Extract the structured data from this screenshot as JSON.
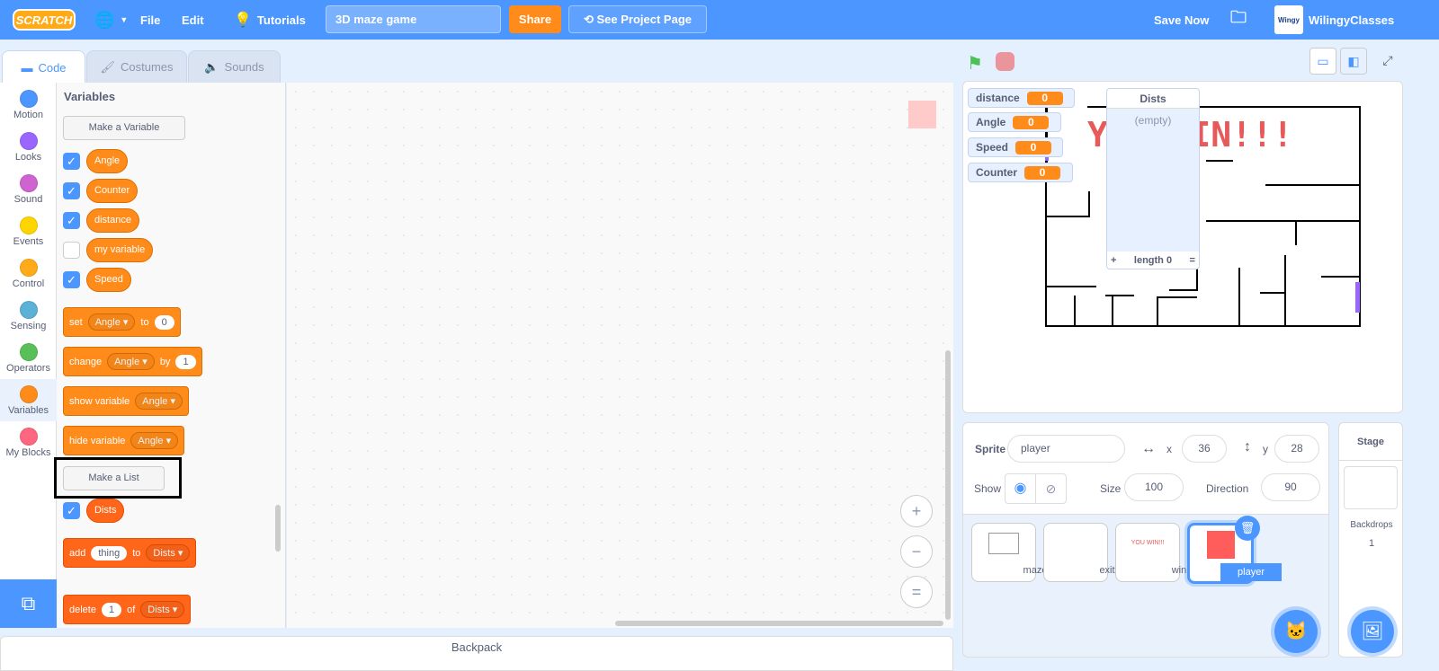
{
  "header": {
    "logo": "SCRATCH",
    "file": "File",
    "edit": "Edit",
    "tutorials": "Tutorials",
    "project_title": "3D maze game",
    "share": "Share",
    "see_project_page": "See Project Page",
    "save_now": "Save Now",
    "username": "WilingyClasses",
    "avatar_text": "Wingy"
  },
  "tabs": [
    {
      "label": "Code"
    },
    {
      "label": "Costumes"
    },
    {
      "label": "Sounds"
    }
  ],
  "categories": [
    {
      "label": "Motion",
      "color": "#4c97ff"
    },
    {
      "label": "Looks",
      "color": "#9966ff"
    },
    {
      "label": "Sound",
      "color": "#cf63cf"
    },
    {
      "label": "Events",
      "color": "#ffd500"
    },
    {
      "label": "Control",
      "color": "#ffab19"
    },
    {
      "label": "Sensing",
      "color": "#5cb1d6"
    },
    {
      "label": "Operators",
      "color": "#59c059"
    },
    {
      "label": "Variables",
      "color": "#ff8c1a"
    },
    {
      "label": "My Blocks",
      "color": "#ff6680"
    }
  ],
  "palette": {
    "title": "Variables",
    "make_variable": "Make a Variable",
    "variables": [
      {
        "name": "Angle",
        "checked": true
      },
      {
        "name": "Counter",
        "checked": true
      },
      {
        "name": "distance",
        "checked": true
      },
      {
        "name": "my variable",
        "checked": false
      },
      {
        "name": "Speed",
        "checked": true
      }
    ],
    "blocks": {
      "set": {
        "w1": "set",
        "var": "Angle",
        "w2": "to",
        "val": "0"
      },
      "change": {
        "w1": "change",
        "var": "Angle",
        "w2": "by",
        "val": "1"
      },
      "show": {
        "w1": "show variable",
        "var": "Angle"
      },
      "hide": {
        "w1": "hide variable",
        "var": "Angle"
      }
    },
    "make_list": "Make a List",
    "lists": [
      {
        "name": "Dists",
        "checked": true
      }
    ],
    "list_blocks": {
      "add": {
        "w1": "add",
        "val": "thing",
        "w2": "to",
        "list": "Dists"
      },
      "delete": {
        "w1": "delete",
        "val": "1",
        "w2": "of",
        "list": "Dists"
      }
    }
  },
  "zoom": {
    "in": "+",
    "out": "−",
    "reset": "="
  },
  "backpack": "Backpack",
  "stage": {
    "monitors": [
      {
        "name": "distance",
        "value": "0"
      },
      {
        "name": "Angle",
        "value": "0"
      },
      {
        "name": "Speed",
        "value": "0"
      },
      {
        "name": "Counter",
        "value": "0"
      }
    ],
    "list_monitor": {
      "title": "Dists",
      "empty": "(empty)",
      "add": "+",
      "length": "length 0",
      "resize": "="
    },
    "win_text": "YOU WIN!!!"
  },
  "sprite_info": {
    "sprite_label": "Sprite",
    "name": "player",
    "x_label": "x",
    "x": "36",
    "y_label": "y",
    "y": "28",
    "show_label": "Show",
    "size_label": "Size",
    "size": "100",
    "direction_label": "Direction",
    "direction": "90"
  },
  "sprites": [
    {
      "name": "maze"
    },
    {
      "name": "exit"
    },
    {
      "name": "win",
      "thumb_text": "YOU WIN!!!"
    },
    {
      "name": "player",
      "selected": true
    }
  ],
  "stage_pane": {
    "title": "Stage",
    "backdrops_label": "Backdrops",
    "backdrops_count": "1"
  }
}
